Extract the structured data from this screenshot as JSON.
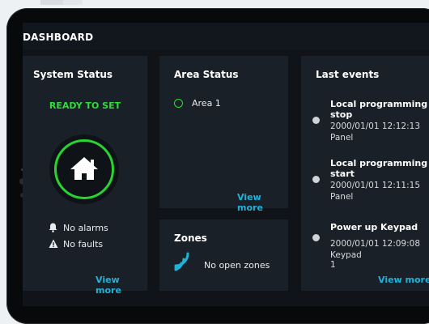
{
  "header": {
    "title": "DASHBOARD"
  },
  "system_status": {
    "title": "System Status",
    "state": "READY TO SET",
    "alarms": "No alarms",
    "faults": "No faults",
    "view_more": "View more",
    "ring_color": "#28d431"
  },
  "area_status": {
    "title": "Area Status",
    "areas": [
      {
        "label": "Area 1"
      }
    ],
    "view_more": "View more"
  },
  "zones": {
    "title": "Zones",
    "status": "No open zones"
  },
  "last_events": {
    "title": "Last events",
    "events": [
      {
        "title": "Local programming stop",
        "time": "2000/01/01 12:12:13",
        "source": "Panel"
      },
      {
        "title": "Local programming start",
        "time": "2000/01/01 12:11:15",
        "source": "Panel"
      },
      {
        "title": "Power up Keypad",
        "time": "2000/01/01 12:09:08",
        "source": "Keypad 1"
      }
    ],
    "view_more": "View more"
  },
  "colors": {
    "accent": "#1fb3d9",
    "ready": "#2fdc3a",
    "card": "#1a2027",
    "background": "#101419"
  },
  "icons": [
    "home-icon",
    "bell-icon",
    "warning-icon",
    "wireless-icon",
    "event-dot-icon"
  ]
}
